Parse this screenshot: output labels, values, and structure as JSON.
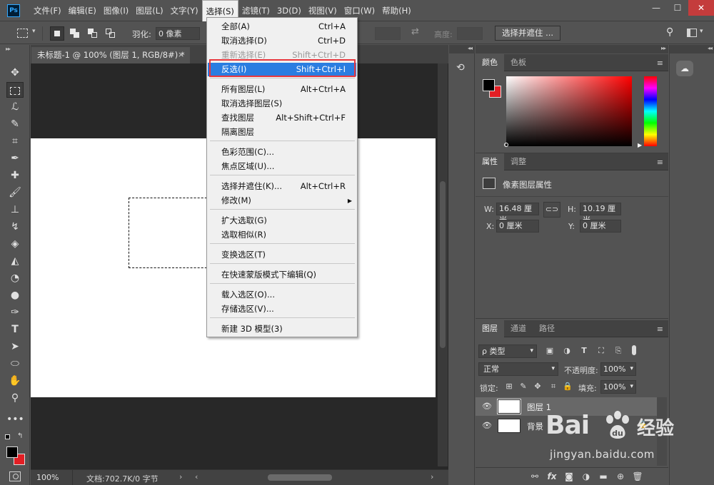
{
  "app": {
    "logo": "Ps"
  },
  "menubar": {
    "items": [
      "文件(F)",
      "编辑(E)",
      "图像(I)",
      "图层(L)",
      "文字(Y)",
      "选择(S)",
      "滤镜(T)",
      "3D(D)",
      "视图(V)",
      "窗口(W)",
      "帮助(H)"
    ],
    "open_index": 5
  },
  "window": {
    "minimize": "—",
    "maximize": "☐",
    "close": "✕"
  },
  "options": {
    "feather_label": "羽化:",
    "feather_value": "0 像素",
    "height_label": "高度:",
    "select_mask": "选择并遮住 ..."
  },
  "document": {
    "tab_title": "未标题-1 @ 100% (图层 1, RGB/8#) *",
    "tab_close": "×",
    "zoom": "100%",
    "info": "文档:702.7K/0 字节"
  },
  "dropdown": {
    "items": [
      {
        "label": "全部(A)",
        "shortcut": "Ctrl+A"
      },
      {
        "label": "取消选择(D)",
        "shortcut": "Ctrl+D"
      },
      {
        "label": "重新选择(E)",
        "shortcut": "Shift+Ctrl+D",
        "disabled": true
      },
      {
        "label": "反选(I)",
        "shortcut": "Shift+Ctrl+I",
        "highlighted": true
      },
      {
        "label": "所有图层(L)",
        "shortcut": "Alt+Ctrl+A"
      },
      {
        "label": "取消选择图层(S)",
        "shortcut": ""
      },
      {
        "label": "查找图层",
        "shortcut": "Alt+Shift+Ctrl+F"
      },
      {
        "label": "隔离图层",
        "shortcut": ""
      },
      {
        "label": "色彩范围(C)...",
        "shortcut": ""
      },
      {
        "label": "焦点区域(U)...",
        "shortcut": ""
      },
      {
        "label": "选择并遮住(K)...",
        "shortcut": "Alt+Ctrl+R"
      },
      {
        "label": "修改(M)",
        "shortcut": "",
        "submenu": true
      },
      {
        "label": "扩大选取(G)",
        "shortcut": ""
      },
      {
        "label": "选取相似(R)",
        "shortcut": ""
      },
      {
        "label": "变换选区(T)",
        "shortcut": ""
      },
      {
        "label": "在快速蒙版模式下编辑(Q)",
        "shortcut": ""
      },
      {
        "label": "载入选区(O)...",
        "shortcut": ""
      },
      {
        "label": "存储选区(V)...",
        "shortcut": ""
      },
      {
        "label": "新建 3D 模型(3)",
        "shortcut": ""
      }
    ]
  },
  "color_panel": {
    "tabs": [
      "颜色",
      "色板"
    ],
    "foreground": "#000000",
    "background": "#e31e24"
  },
  "properties_panel": {
    "tabs": [
      "属性",
      "调整"
    ],
    "title": "像素图层属性",
    "w_label": "W:",
    "w_value": "16.48 厘米",
    "h_label": "H:",
    "h_value": "10.19 厘米",
    "x_label": "X:",
    "x_value": "0 厘米",
    "y_label": "Y:",
    "y_value": "0 厘米"
  },
  "layers_panel": {
    "tabs": [
      "图层",
      "通道",
      "路径"
    ],
    "filter": "ρ 类型",
    "blend_mode": "正常",
    "opacity_label": "不透明度:",
    "opacity": "100%",
    "lock_label": "锁定:",
    "fill_label": "填充:",
    "fill": "100%",
    "layers": [
      {
        "name": "图层 1",
        "active": true
      },
      {
        "name": "背景",
        "locked": true
      }
    ]
  },
  "watermark": {
    "brand": "Bai",
    "brand_cn": "经验",
    "url": "jingyan.baidu.com"
  }
}
